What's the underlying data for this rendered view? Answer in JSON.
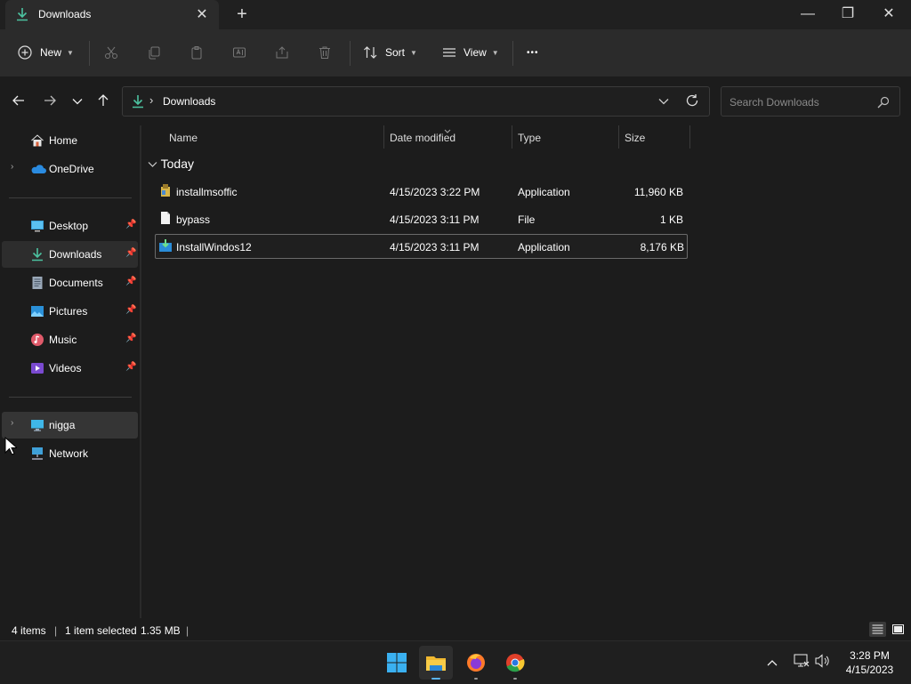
{
  "window": {
    "tab_title": "Downloads",
    "new_tab": "+",
    "close_tab": "✕",
    "minimize": "—",
    "restore": "❐",
    "close": "✕"
  },
  "toolbar": {
    "new_label": "New",
    "sort_label": "Sort",
    "view_label": "View",
    "more_label": "•••"
  },
  "address": {
    "path": "Downloads",
    "separator": "›"
  },
  "search": {
    "placeholder": "Search Downloads"
  },
  "sidebar": {
    "items": [
      {
        "label": "Home"
      },
      {
        "label": "OneDrive"
      },
      {
        "label": "Desktop"
      },
      {
        "label": "Downloads"
      },
      {
        "label": "Documents"
      },
      {
        "label": "Pictures"
      },
      {
        "label": "Music"
      },
      {
        "label": "Videos"
      },
      {
        "label": "nigga"
      },
      {
        "label": "Network"
      }
    ]
  },
  "columns": [
    "Name",
    "Date modified",
    "Type",
    "Size"
  ],
  "group": "Today",
  "files": [
    {
      "name": "installmsoffic",
      "date": "4/15/2023 3:22 PM",
      "type": "Application",
      "size": "11,960 KB"
    },
    {
      "name": "bypass",
      "date": "4/15/2023 3:11 PM",
      "type": "File",
      "size": "1 KB"
    },
    {
      "name": "InstallWindos12",
      "date": "4/15/2023 3:11 PM",
      "type": "Application",
      "size": "8,176 KB"
    }
  ],
  "status": {
    "count": "4 items",
    "selected": "1 item selected",
    "size": "1.35 MB"
  },
  "taskbar": {
    "time": "3:28 PM",
    "date": "4/15/2023"
  },
  "colors": {
    "accent": "#4cc2a0",
    "background": "#1c1c1c"
  }
}
